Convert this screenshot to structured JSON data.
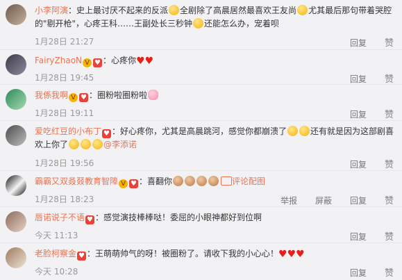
{
  "comments": [
    {
      "user": "小李阿演",
      "sep": "：",
      "text1": "史上最讨厌不起来的反派",
      "text2": "全剧除了高晨居然最喜欢王友尚",
      "text3": "尤其最后那句带着哭腔的\"剔开枪\"，心疼王科……王副处长三秒钟",
      "text4": "还能怎么办，宠着呗",
      "time": "1月28日 21:27",
      "reply": "回复",
      "like": "赞"
    },
    {
      "user": "FairyZhaoN",
      "sep": "：",
      "text": "心疼你",
      "time": "1月28日 19:45",
      "reply": "回复",
      "like": "赞"
    },
    {
      "user": "我係我啊",
      "sep": "：",
      "text": "圈粉啦圈粉啦",
      "time": "1月28日 19:11",
      "reply": "回复",
      "like": "赞"
    },
    {
      "user": "爱吃红豆的小布丁",
      "sep": "：",
      "text1": "好心疼你，尤其是高晨跳河，感觉你都崩溃了",
      "text2": "还有就是因为这部剧喜欢上你了",
      "mention": "@李添诺",
      "time": "1月28日 19:56",
      "reply": "回复",
      "like": "赞"
    },
    {
      "user": "霸霸又双叒叕教育智障",
      "sep": "：",
      "text": "喜翻你",
      "tag": "评论配图",
      "time": "1月28日 18:23",
      "report": "举报",
      "block": "屏蔽",
      "reply": "回复",
      "like": "赞"
    },
    {
      "user": "唇诺说子不语",
      "sep": "：",
      "text": "感觉演技棒棒哒！委屈的小眼神都好到位啊",
      "time": "今天 11:13",
      "reply": "回复",
      "like": "赞"
    },
    {
      "user": "老脸柯察金",
      "sep": "：",
      "text": "王萌萌帅气的呀！被圈粉了。请收下我的小心心！",
      "time": "今天 10:28",
      "reply": "回复",
      "like": "赞"
    }
  ]
}
